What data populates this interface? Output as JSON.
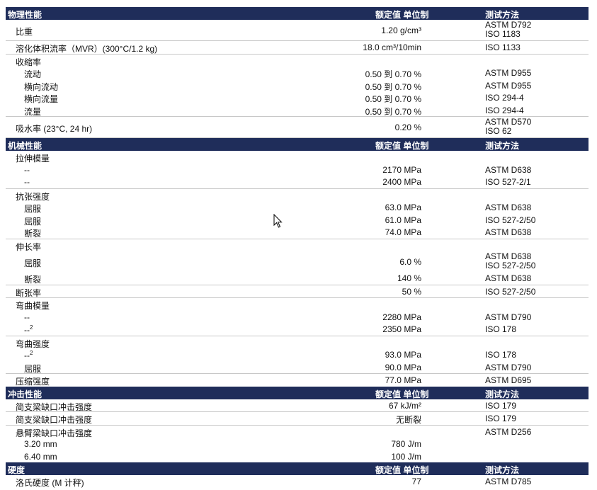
{
  "headers": {
    "value": "额定值 单位制",
    "method": "测试方法"
  },
  "sections": [
    {
      "title": "物理性能",
      "groups": [
        {
          "rows": [
            {
              "label": "比重",
              "level": 0,
              "value": "1.20 g/cm³",
              "methods": [
                "ASTM D792",
                "ISO 1183"
              ]
            }
          ]
        },
        {
          "rows": [
            {
              "label": "溶化体积流率（MVR）(300°C/1.2 kg)",
              "level": 0,
              "value": "18.0 cm³/10min",
              "methods": [
                "ISO 1133"
              ]
            }
          ]
        },
        {
          "rows": [
            {
              "label": "收缩率",
              "level": 0,
              "value": "",
              "methods": []
            },
            {
              "label": "流动",
              "level": 1,
              "value": "0.50 到 0.70 %",
              "methods": [
                "ASTM D955"
              ]
            },
            {
              "label": "横向流动",
              "level": 1,
              "value": "0.50 到 0.70 %",
              "methods": [
                "ASTM D955"
              ]
            },
            {
              "label": "横向流量",
              "level": 1,
              "value": "0.50 到 0.70 %",
              "methods": [
                "ISO 294-4"
              ]
            },
            {
              "label": "流量",
              "level": 1,
              "value": "0.50 到 0.70 %",
              "methods": [
                "ISO 294-4"
              ]
            }
          ]
        },
        {
          "rows": [
            {
              "label": "吸水率 (23°C, 24 hr)",
              "level": 0,
              "value": "0.20 %",
              "methods": [
                "ASTM D570",
                "ISO 62"
              ]
            }
          ]
        }
      ]
    },
    {
      "title": "机械性能",
      "groups": [
        {
          "rows": [
            {
              "label": "拉伸模量",
              "level": 0,
              "value": "",
              "methods": []
            },
            {
              "label": "--",
              "level": 1,
              "value": "2170 MPa",
              "methods": [
                "ASTM D638"
              ]
            },
            {
              "label": "--",
              "level": 1,
              "value": "2400 MPa",
              "methods": [
                "ISO 527-2/1"
              ]
            }
          ]
        },
        {
          "rows": [
            {
              "label": "抗张强度",
              "level": 0,
              "value": "",
              "methods": []
            },
            {
              "label": "屈服",
              "level": 1,
              "value": "63.0 MPa",
              "methods": [
                "ASTM D638"
              ]
            },
            {
              "label": "屈服",
              "level": 1,
              "value": "61.0 MPa",
              "methods": [
                "ISO 527-2/50"
              ]
            },
            {
              "label": "断裂",
              "level": 1,
              "value": "74.0 MPa",
              "methods": [
                "ASTM D638"
              ]
            }
          ]
        },
        {
          "rows": [
            {
              "label": "伸长率",
              "level": 0,
              "value": "",
              "methods": []
            },
            {
              "label": "屈服",
              "level": 1,
              "value": "6.0 %",
              "methods": [
                "ASTM D638",
                "ISO 527-2/50"
              ]
            },
            {
              "label": "断裂",
              "level": 1,
              "value": "140 %",
              "methods": [
                "ASTM D638"
              ]
            }
          ]
        },
        {
          "rows": [
            {
              "label": "断张率",
              "level": 0,
              "value": "50 %",
              "methods": [
                "ISO 527-2/50"
              ]
            }
          ]
        },
        {
          "rows": [
            {
              "label": "弯曲模量",
              "level": 0,
              "value": "",
              "methods": []
            },
            {
              "label": "--",
              "level": 1,
              "value": "2280 MPa",
              "methods": [
                "ASTM D790"
              ]
            },
            {
              "label": "--",
              "sup": "2",
              "level": 1,
              "value": "2350 MPa",
              "methods": [
                "ISO 178"
              ]
            }
          ]
        },
        {
          "rows": [
            {
              "label": "弯曲强度",
              "level": 0,
              "value": "",
              "methods": []
            },
            {
              "label": "--",
              "sup": "2",
              "level": 1,
              "value": "93.0 MPa",
              "methods": [
                "ISO 178"
              ]
            },
            {
              "label": "屈服",
              "level": 1,
              "value": "90.0 MPa",
              "methods": [
                "ASTM D790"
              ]
            }
          ]
        },
        {
          "last": true,
          "rows": [
            {
              "label": "压缩强度",
              "level": 0,
              "value": "77.0 MPa",
              "methods": [
                "ASTM D695"
              ]
            }
          ]
        }
      ]
    },
    {
      "title": "冲击性能",
      "groups": [
        {
          "rows": [
            {
              "label": "简支梁缺口冲击强度",
              "level": 0,
              "value": "67 kJ/m²",
              "methods": [
                "ISO 179"
              ]
            }
          ]
        },
        {
          "rows": [
            {
              "label": "简支梁缺口冲击强度",
              "level": 0,
              "value": "无断裂",
              "methods": [
                "ISO 179"
              ]
            }
          ]
        },
        {
          "last": true,
          "rows": [
            {
              "label": "悬臂梁缺口冲击强度",
              "level": 0,
              "value": "",
              "methods": [
                "ASTM D256"
              ]
            },
            {
              "label": "3.20 mm",
              "level": 1,
              "value": "780 J/m",
              "methods": []
            },
            {
              "label": "6.40 mm",
              "level": 1,
              "value": "100 J/m",
              "methods": []
            }
          ]
        }
      ]
    },
    {
      "title": "硬度",
      "groups": [
        {
          "last": true,
          "rows": [
            {
              "label": "洛氏硬度 (M 计秤)",
              "level": 0,
              "value": "77",
              "methods": [
                "ASTM D785"
              ]
            }
          ]
        }
      ]
    }
  ]
}
